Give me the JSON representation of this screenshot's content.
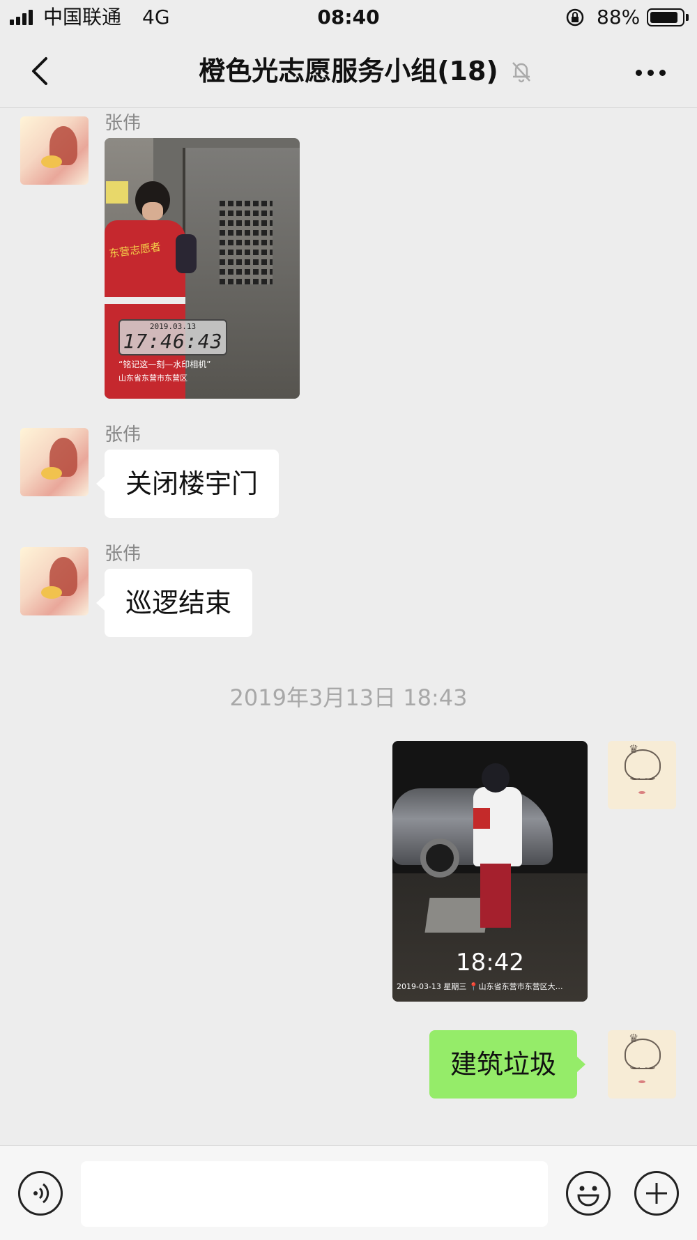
{
  "status_bar": {
    "carrier": "中国联通",
    "network": "4G",
    "time": "08:40",
    "battery_percent": "88%",
    "battery_level": 0.88
  },
  "nav": {
    "title": "橙色光志愿服务小组(18)",
    "muted": true
  },
  "messages": [
    {
      "type": "image",
      "direction": "in",
      "sender": "张伟",
      "image": {
        "vest_text": "东营志愿者",
        "watermark_date": "2019.03.13",
        "watermark_time": "17:46:43",
        "quote": "“铭记这一刻—水印相机”",
        "location": "山东省东营市东营区"
      }
    },
    {
      "type": "text",
      "direction": "in",
      "sender": "张伟",
      "text": "关闭楼宇门"
    },
    {
      "type": "text",
      "direction": "in",
      "sender": "张伟",
      "text": "巡逻结束"
    },
    {
      "type": "timestamp",
      "text": "2019年3月13日 18:43"
    },
    {
      "type": "image",
      "direction": "out",
      "image": {
        "time": "18:42",
        "caption": "2019-03-13   星期三 📍山东省东营市东营区大…"
      }
    },
    {
      "type": "text",
      "direction": "out",
      "text": "建筑垃圾"
    }
  ],
  "input": {
    "value": "",
    "placeholder": ""
  },
  "icons": {
    "back": "chevron-left-icon",
    "mute": "bell-off-icon",
    "more": "more-dots-icon",
    "voice": "voice-icon",
    "emoji": "emoji-icon",
    "plus": "plus-icon"
  },
  "colors": {
    "background": "#ededed",
    "outgoing_bubble": "#95ec69",
    "incoming_bubble": "#ffffff"
  }
}
